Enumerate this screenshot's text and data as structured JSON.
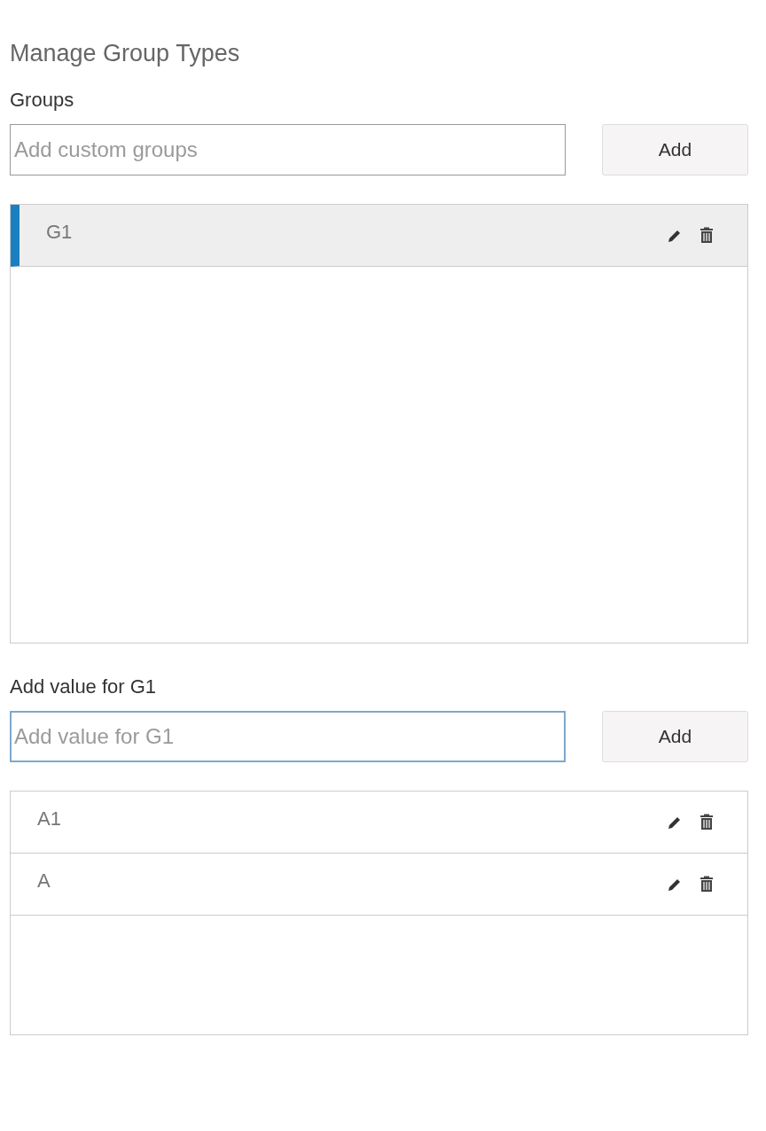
{
  "title": "Manage Group Types",
  "sections": [
    {
      "label": "Groups",
      "input": {
        "placeholder": "Add custom groups",
        "focused": false
      },
      "button": "Add",
      "items": [
        {
          "label": "G1",
          "selected": true
        }
      ]
    },
    {
      "label": "Add value for G1",
      "input": {
        "placeholder": "Add value for G1",
        "focused": true
      },
      "button": "Add",
      "items": [
        {
          "label": "A1",
          "selected": false
        },
        {
          "label": "A",
          "selected": false
        }
      ]
    }
  ]
}
